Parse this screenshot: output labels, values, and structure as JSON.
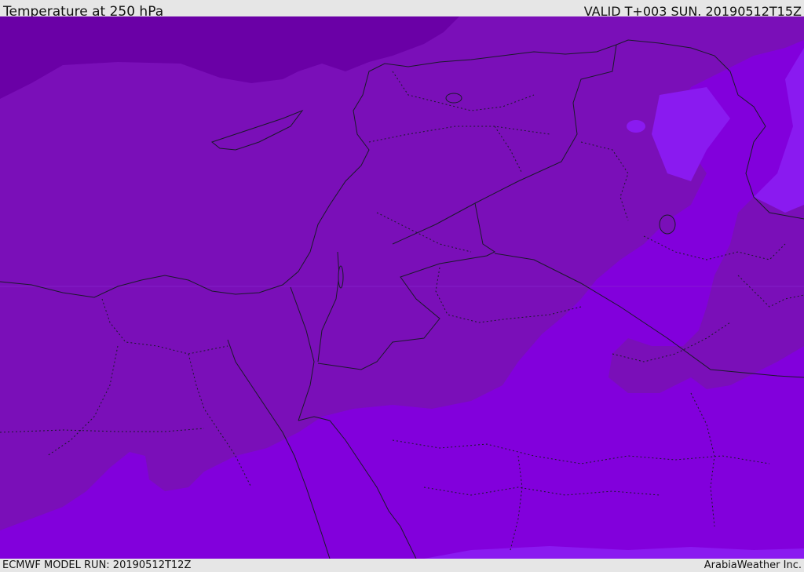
{
  "header": {
    "title": "Temperature at 250 hPa",
    "valid_time": "VALID T+003 SUN. 20190512T15Z"
  },
  "footer": {
    "model_run": "ECMWF MODEL RUN: 20190512T12Z",
    "credit": "ArabiaWeather Inc."
  },
  "colors": {
    "deep_purple": "#6a00a6",
    "mid_purple": "#7a0fb8",
    "violet": "#8200dc",
    "bright_violet": "#8a1af0"
  }
}
